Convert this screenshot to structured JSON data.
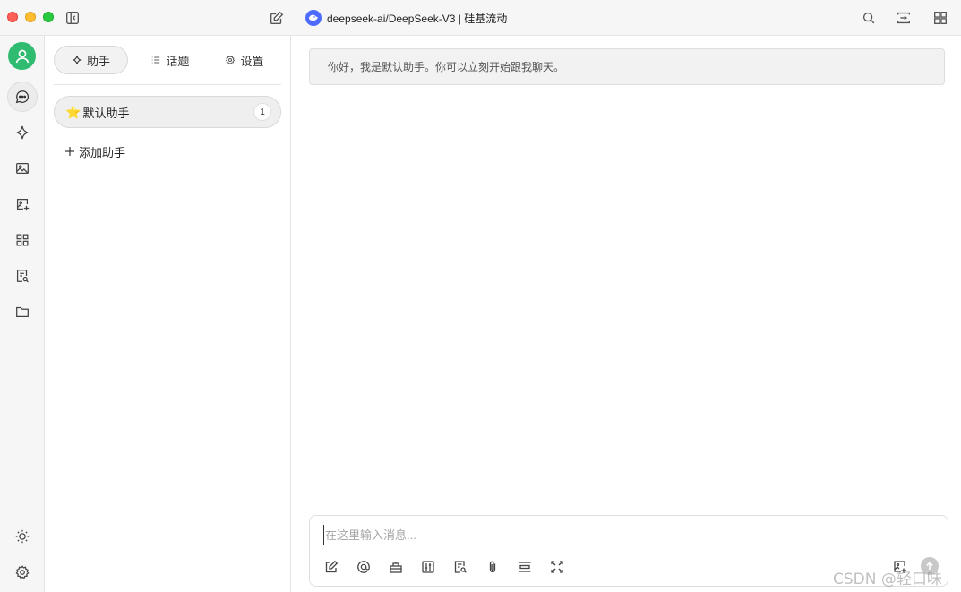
{
  "titlebar": {
    "model_title": "deepseek-ai/DeepSeek-V3 | 硅基流动",
    "icons": [
      "sidebar-toggle-icon",
      "new-chat-icon",
      "search-icon",
      "expand-icon",
      "layout-grid-icon"
    ]
  },
  "rail": {
    "icons": [
      "user-avatar-icon",
      "chat-icon",
      "sparkle-icon",
      "image-icon",
      "image-edit-icon",
      "apps-grid-icon",
      "document-search-icon",
      "folder-icon",
      "theme-sun-icon",
      "settings-gear-icon"
    ]
  },
  "panel": {
    "tabs": [
      {
        "label": "助手",
        "icon": "sparkle-icon"
      },
      {
        "label": "话题",
        "icon": "list-icon"
      },
      {
        "label": "设置",
        "icon": "gear-icon"
      }
    ],
    "assistant": {
      "emoji": "⭐️",
      "name": "默认助手",
      "count": "1"
    },
    "add_label": "添加助手"
  },
  "chat": {
    "greeting": "你好，我是默认助手。你可以立刻开始跟我聊天。"
  },
  "composer": {
    "placeholder": "在这里输入消息...",
    "value": "",
    "tools": [
      "edit-icon",
      "mention-at-icon",
      "toolbox-icon",
      "sliders-icon",
      "document-search-icon",
      "paperclip-icon",
      "divider-icon",
      "fullscreen-icon",
      "translate-icon"
    ]
  },
  "watermark": "CSDN @轻口味",
  "colors": {
    "accent": "#2fbc71",
    "model_logo": "#4d6bfe"
  }
}
